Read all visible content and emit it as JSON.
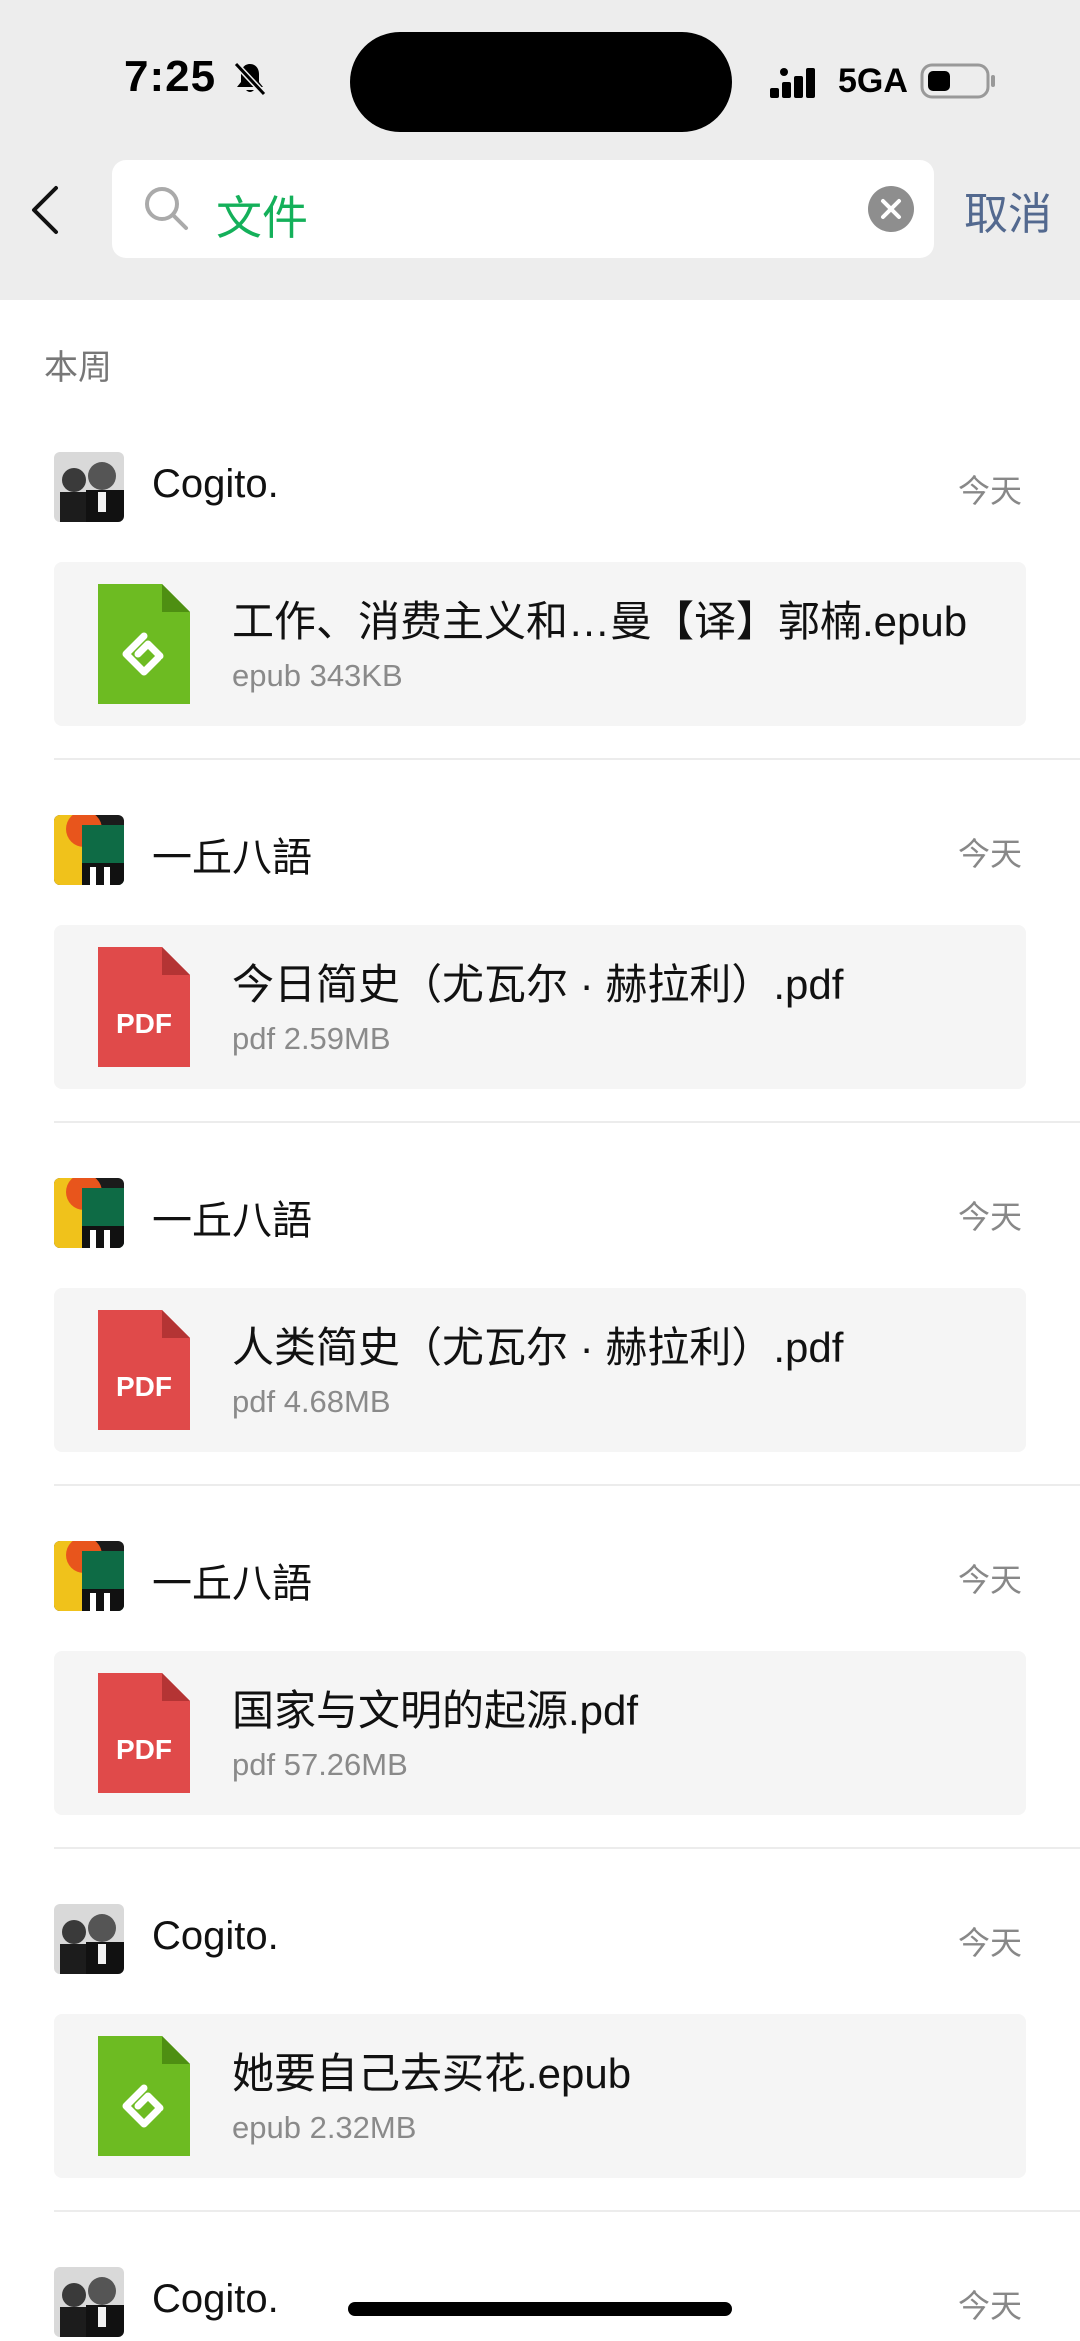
{
  "status_bar": {
    "time": "7:25",
    "network": "5GA"
  },
  "search": {
    "query": "文件",
    "cancel_label": "取消"
  },
  "section_label": "本周",
  "entries": [
    {
      "sender": "Cogito.",
      "avatar": "cogito",
      "date": "今天",
      "file_type": "epub",
      "file_name": "工作、消费主义和…曼【译】郭楠.epub",
      "file_meta": "epub 343KB"
    },
    {
      "sender": "一丘八語",
      "avatar": "yiqiu",
      "date": "今天",
      "file_type": "pdf",
      "file_name": "今日简史（尤瓦尔 · 赫拉利）.pdf",
      "file_meta": "pdf 2.59MB"
    },
    {
      "sender": "一丘八語",
      "avatar": "yiqiu",
      "date": "今天",
      "file_type": "pdf",
      "file_name": "人类简史（尤瓦尔 · 赫拉利）.pdf",
      "file_meta": "pdf 4.68MB"
    },
    {
      "sender": "一丘八語",
      "avatar": "yiqiu",
      "date": "今天",
      "file_type": "pdf",
      "file_name": "国家与文明的起源.pdf",
      "file_meta": "pdf 57.26MB"
    },
    {
      "sender": "Cogito.",
      "avatar": "cogito",
      "date": "今天",
      "file_type": "epub",
      "file_name": "她要自己去买花.epub",
      "file_meta": "epub 2.32MB"
    },
    {
      "sender": "Cogito.",
      "avatar": "cogito",
      "date": "今天"
    }
  ],
  "icons": {
    "pdf_label": "PDF",
    "pdf_color": "#e04a4a",
    "epub_color": "#6dbb22"
  },
  "colors": {
    "search_text": "#14b05a",
    "cancel_text": "#53698f",
    "top_background": "#ededed"
  }
}
